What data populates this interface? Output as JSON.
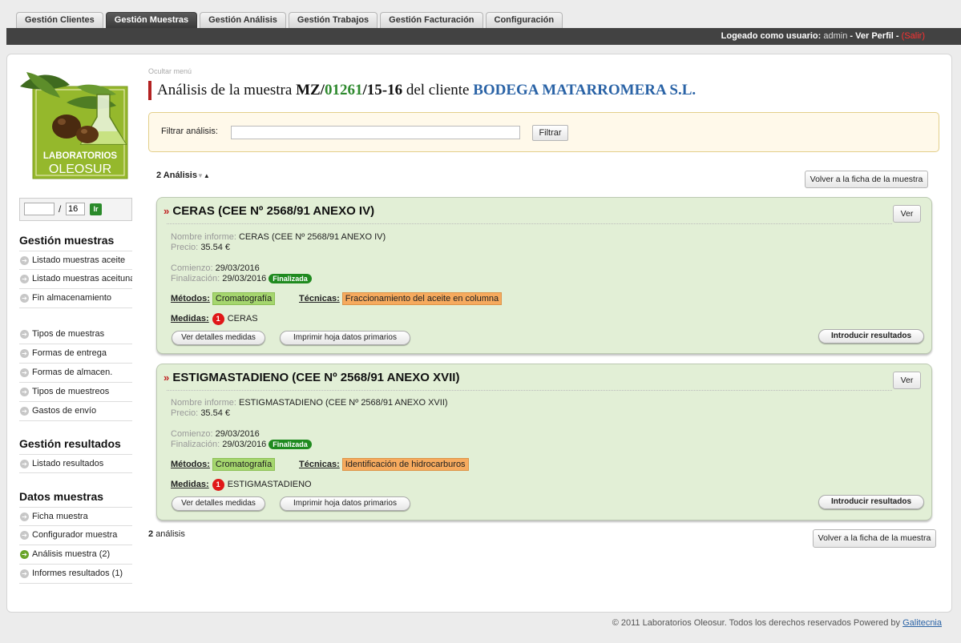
{
  "tabs": [
    {
      "label": "Gestión Clientes"
    },
    {
      "label": "Gestión Muestras"
    },
    {
      "label": "Gestión Análisis"
    },
    {
      "label": "Gestión Trabajos"
    },
    {
      "label": "Gestión Facturación"
    },
    {
      "label": "Configuración"
    }
  ],
  "active_tab": "Gestión Muestras",
  "topbar": {
    "logged_label": "Logeado como usuario:",
    "username": "admin",
    "sep1": "-",
    "profile": "Ver Perfil",
    "sep2": "-",
    "logout": "(Salir)"
  },
  "logo": {
    "line1": "LABORATORIOS",
    "line2": "OLEOSUR"
  },
  "pager": {
    "current": "",
    "slash": "/",
    "total": "16",
    "go": "Ir"
  },
  "sidebar": {
    "gestion_muestras": {
      "title": "Gestión muestras",
      "items": [
        "Listado muestras aceite",
        "Listado muestras aceituna",
        "Fin almacenamiento"
      ],
      "items2": [
        "Tipos de muestras",
        "Formas de entrega",
        "Formas de almacen.",
        "Tipos de muestreos",
        "Gastos de envío"
      ]
    },
    "gestion_resultados": {
      "title": "Gestión resultados",
      "items": [
        "Listado resultados"
      ]
    },
    "datos_muestras": {
      "title": "Datos muestras",
      "items": [
        "Ficha muestra",
        "Configurador muestra",
        "Análisis muestra (2)",
        "Informes resultados (1)"
      ],
      "active": "Análisis muestra (2)"
    }
  },
  "main": {
    "hide_menu": "Ocultar menú",
    "title": {
      "prefix": "Análisis de la muestra",
      "code_a": "MZ/",
      "code_b": "01261",
      "code_c": "/15-16",
      "middle": "del cliente",
      "client": "BODEGA MATARROMERA S.L."
    },
    "filter": {
      "label": "Filtrar análisis:",
      "value": "",
      "button": "Filtrar"
    },
    "count_top": {
      "num": "2",
      "label": "Análisis"
    },
    "back_button": "Volver a la ficha de la muestra",
    "count_bottom": {
      "num": "2",
      "label": "análisis"
    }
  },
  "cards": [
    {
      "title": "CERAS (CEE Nº 2568/91 ANEXO IV)",
      "view_button": "Ver",
      "report_name_label": "Nombre informe:",
      "report_name": "CERAS (CEE Nº 2568/91 ANEXO IV)",
      "price_label": "Precio:",
      "price": "35.54 €",
      "start_label": "Comienzo:",
      "start": "29/03/2016",
      "end_label": "Finalización:",
      "end": "29/03/2016",
      "status": "Finalizada",
      "methods_label": "Métodos:",
      "method": "Cromatografía",
      "techniques_label": "Técnicas:",
      "technique": "Fraccionamiento del aceite en columna",
      "measures_label": "Medidas:",
      "measures_count": "1",
      "measure": "CERAS",
      "details_button": "Ver detalles medidas",
      "print_button": "Imprimir hoja datos primarios",
      "results_button": "Introducir resultados"
    },
    {
      "title": "ESTIGMASTADIENO (CEE Nº 2568/91 ANEXO XVII)",
      "view_button": "Ver",
      "report_name_label": "Nombre informe:",
      "report_name": "ESTIGMASTADIENO (CEE Nº 2568/91 ANEXO XVII)",
      "price_label": "Precio:",
      "price": "35.54 €",
      "start_label": "Comienzo:",
      "start": "29/03/2016",
      "end_label": "Finalización:",
      "end": "29/03/2016",
      "status": "Finalizada",
      "methods_label": "Métodos:",
      "method": "Cromatografía",
      "techniques_label": "Técnicas:",
      "technique": "Identificación de hidrocarburos",
      "measures_label": "Medidas:",
      "measures_count": "1",
      "measure": "ESTIGMASTADIENO",
      "details_button": "Ver detalles medidas",
      "print_button": "Imprimir hoja datos primarios",
      "results_button": "Introducir resultados"
    }
  ],
  "footer": {
    "text": "© 2011 Laboratorios Oleosur. Todos los derechos reservados Powered by",
    "link": "Galitecnia"
  },
  "colors": {
    "topbar": "#424242",
    "card_bg": "#e2efd6",
    "title_accent": "#b32222",
    "client_blue": "#2a63a6",
    "code_green": "#2f8a2f",
    "status_green": "#1f8a1f",
    "method_tag": "#a5d66e",
    "technique_tag": "#f6aa5e",
    "logout_red": "#ff3030"
  }
}
